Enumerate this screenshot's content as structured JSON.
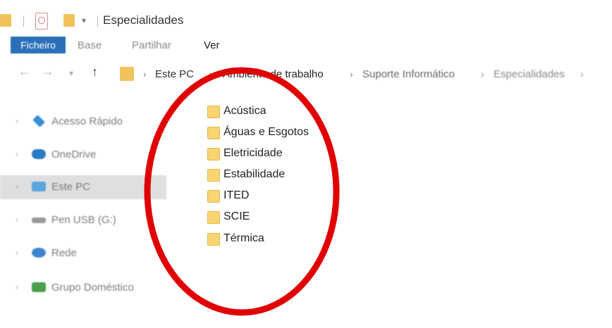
{
  "window": {
    "title": "Especialidades"
  },
  "ribbon": {
    "tabs": [
      "Ficheiro",
      "Base",
      "Partilhar",
      "Ver"
    ]
  },
  "address": {
    "crumbs": [
      "Este PC",
      "Ambiente de trabalho",
      "Suporte Informático",
      "Especialidades"
    ]
  },
  "sidebar": {
    "items": [
      {
        "label": "Acesso Rápido",
        "icon": "star-icon"
      },
      {
        "label": "OneDrive",
        "icon": "cloud-icon"
      },
      {
        "label": "Este PC",
        "icon": "computer-icon"
      },
      {
        "label": "Pen USB (G:)",
        "icon": "usb-drive-icon"
      },
      {
        "label": "Rede",
        "icon": "network-icon"
      },
      {
        "label": "Grupo Doméstico",
        "icon": "homegroup-icon"
      }
    ],
    "selected": "Este PC"
  },
  "files": [
    {
      "name": "Acústica"
    },
    {
      "name": "Águas e Esgotos"
    },
    {
      "name": "Eletricidade"
    },
    {
      "name": "Estabilidade"
    },
    {
      "name": "ITED"
    },
    {
      "name": "SCIE"
    },
    {
      "name": "Térmica"
    }
  ],
  "colors": {
    "file_tab": "#2a6fb8",
    "folder": "#f7d572",
    "annotation": "#e00000",
    "selected_row": "#dfdfdf"
  }
}
